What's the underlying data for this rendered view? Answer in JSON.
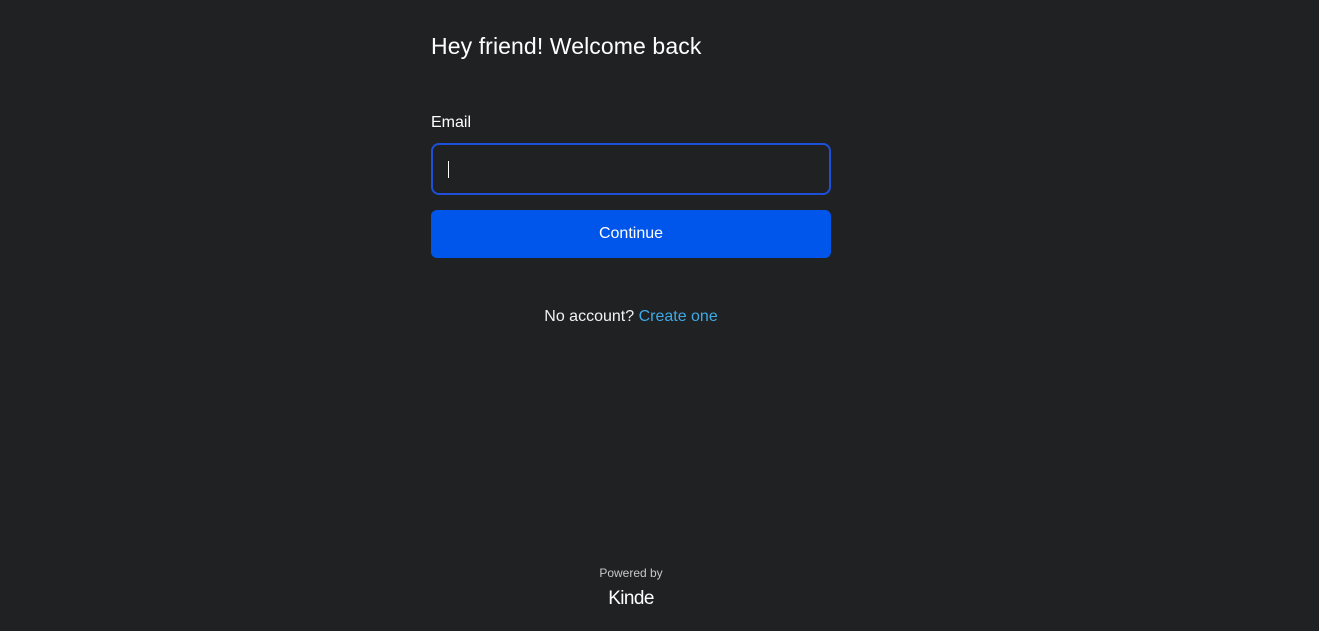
{
  "login": {
    "heading": "Hey friend! Welcome back",
    "email_label": "Email",
    "email_value": "",
    "continue_label": "Continue",
    "no_account_text": "No account?",
    "create_link_text": "Create one"
  },
  "footer": {
    "powered_by": "Powered by",
    "brand": "Kinde"
  },
  "colors": {
    "background": "#1f2123",
    "primary": "#0055eb",
    "focus_border": "#1d4fd8",
    "link": "#3fa9e8"
  }
}
